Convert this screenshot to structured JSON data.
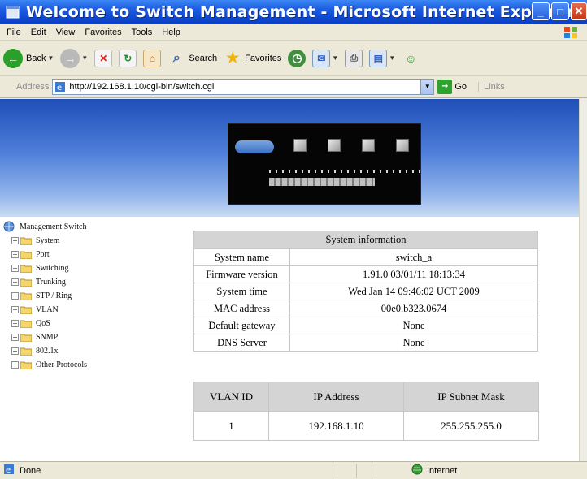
{
  "window": {
    "title": "Welcome to Switch Management - Microsoft Internet Explorer",
    "buttons": [
      "minimize",
      "maximize",
      "close"
    ]
  },
  "menu": {
    "items": [
      "File",
      "Edit",
      "View",
      "Favorites",
      "Tools",
      "Help"
    ]
  },
  "toolbar": {
    "back_label": "Back",
    "search_label": "Search",
    "favorites_label": "Favorites"
  },
  "address": {
    "label": "Address",
    "url": "http://192.168.1.10/cgi-bin/switch.cgi",
    "go_label": "Go",
    "links_label": "Links"
  },
  "tree": {
    "root": "Management Switch",
    "items": [
      "System",
      "Port",
      "Switching",
      "Trunking",
      "STP / Ring",
      "VLAN",
      "QoS",
      "SNMP",
      "802.1x",
      "Other Protocols"
    ]
  },
  "system_info": {
    "title": "System information",
    "rows": [
      {
        "label": "System name",
        "value": "switch_a"
      },
      {
        "label": "Firmware version",
        "value": "1.91.0 03/01/11 18:13:34"
      },
      {
        "label": "System time",
        "value": "Wed Jan 14 09:46:02 UCT 2009"
      },
      {
        "label": "MAC address",
        "value": "00e0.b323.0674"
      },
      {
        "label": "Default gateway",
        "value": "None"
      },
      {
        "label": "DNS Server",
        "value": "None"
      }
    ]
  },
  "vlan_table": {
    "headers": [
      "VLAN ID",
      "IP Address",
      "IP Subnet Mask"
    ],
    "rows": [
      [
        "1",
        "192.168.1.10",
        "255.255.255.0"
      ]
    ]
  },
  "status": {
    "left": "Done",
    "zone": "Internet"
  },
  "colors": {
    "titlebar": "#0f4ad4",
    "table_header": "#d4d4d4",
    "banner": "#4d7ed9"
  }
}
